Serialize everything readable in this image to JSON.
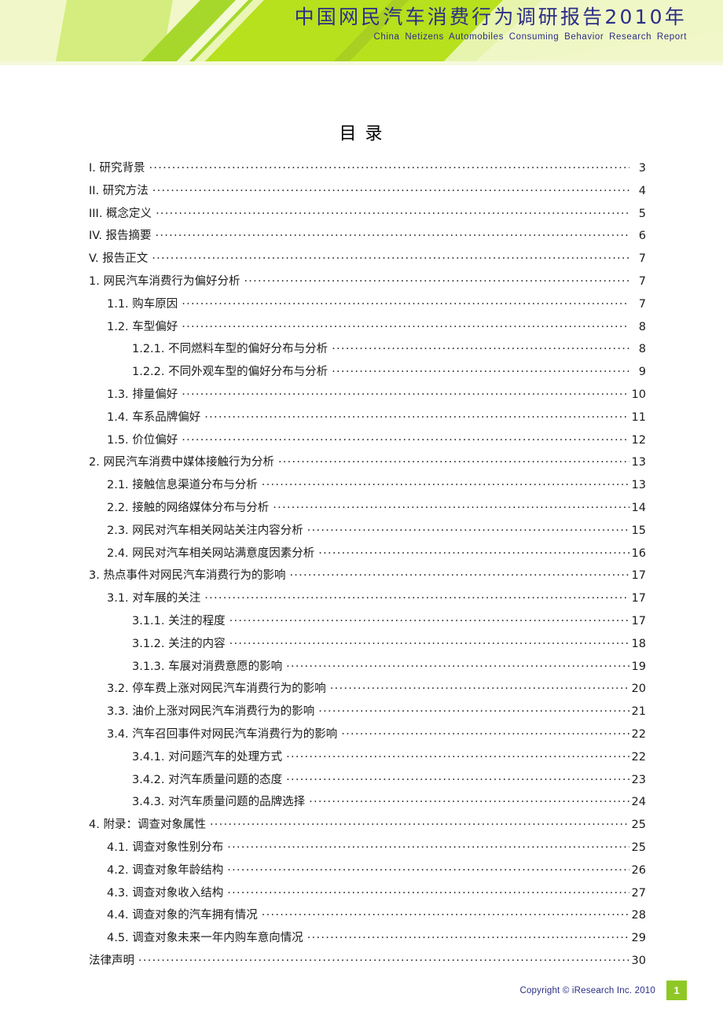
{
  "header": {
    "title_cn": "中国网民汽车消费行为调研报告2010年",
    "title_en": "China  Netizens  Automobiles  Consuming  Behavior  Research  Report",
    "accent_green": "#8fc825",
    "band_pale": "#f2f7c9",
    "band_mid": "#c6e86b",
    "title_color": "#2b2f86"
  },
  "toc": {
    "heading": "目  录",
    "entries": [
      {
        "level": 0,
        "label": "I. 研究背景",
        "page": "3"
      },
      {
        "level": 0,
        "label": "II. 研究方法",
        "page": "4"
      },
      {
        "level": 0,
        "label": "III. 概念定义",
        "page": "5"
      },
      {
        "level": 0,
        "label": "IV. 报告摘要",
        "page": "6"
      },
      {
        "level": 0,
        "label": "V. 报告正文",
        "page": "7"
      },
      {
        "level": 0,
        "label": "1. 网民汽车消费行为偏好分析",
        "page": "7"
      },
      {
        "level": 1,
        "label": "1.1. 购车原因",
        "page": "7"
      },
      {
        "level": 1,
        "label": "1.2. 车型偏好",
        "page": "8"
      },
      {
        "level": 2,
        "label": "1.2.1. 不同燃料车型的偏好分布与分析",
        "page": "8"
      },
      {
        "level": 2,
        "label": "1.2.2. 不同外观车型的偏好分布与分析",
        "page": "9"
      },
      {
        "level": 1,
        "label": "1.3. 排量偏好",
        "page": "10"
      },
      {
        "level": 1,
        "label": "1.4. 车系品牌偏好",
        "page": "11"
      },
      {
        "level": 1,
        "label": "1.5. 价位偏好",
        "page": "12"
      },
      {
        "level": 0,
        "label": "2. 网民汽车消费中媒体接触行为分析",
        "page": "13"
      },
      {
        "level": 1,
        "label": "2.1. 接触信息渠道分布与分析",
        "page": "13"
      },
      {
        "level": 1,
        "label": "2.2. 接触的网络媒体分布与分析",
        "page": "14"
      },
      {
        "level": 1,
        "label": "2.3. 网民对汽车相关网站关注内容分析",
        "page": "15"
      },
      {
        "level": 1,
        "label": "2.4.  网民对汽车相关网站满意度因素分析",
        "page": "16"
      },
      {
        "level": 0,
        "label": "3. 热点事件对网民汽车消费行为的影响",
        "page": "17"
      },
      {
        "level": 1,
        "label": "3.1. 对车展的关注",
        "page": "17"
      },
      {
        "level": 2,
        "label": "3.1.1. 关注的程度",
        "page": "17"
      },
      {
        "level": 2,
        "label": "3.1.2. 关注的内容",
        "page": "18"
      },
      {
        "level": 2,
        "label": "3.1.3. 车展对消费意愿的影响",
        "page": "19"
      },
      {
        "level": 1,
        "label": "3.2. 停车费上涨对网民汽车消费行为的影响",
        "page": "20"
      },
      {
        "level": 1,
        "label": "3.3. 油价上涨对网民汽车消费行为的影响",
        "page": "21"
      },
      {
        "level": 1,
        "label": "3.4. 汽车召回事件对网民汽车消费行为的影响",
        "page": "22"
      },
      {
        "level": 2,
        "label": "3.4.1. 对问题汽车的处理方式",
        "page": "22"
      },
      {
        "level": 2,
        "label": "3.4.2. 对汽车质量问题的态度",
        "page": "23"
      },
      {
        "level": 2,
        "label": "3.4.3. 对汽车质量问题的品牌选择",
        "page": "24"
      },
      {
        "level": 0,
        "label": "4. 附录：调查对象属性",
        "page": "25"
      },
      {
        "level": 1,
        "label": "4.1. 调查对象性别分布",
        "page": "25"
      },
      {
        "level": 1,
        "label": "4.2. 调查对象年龄结构",
        "page": "26"
      },
      {
        "level": 1,
        "label": "4.3. 调查对象收入结构",
        "page": "27"
      },
      {
        "level": 1,
        "label": "4.4. 调查对象的汽车拥有情况",
        "page": "28"
      },
      {
        "level": 1,
        "label": "4.5. 调查对象未来一年内购车意向情况",
        "page": "29"
      },
      {
        "level": 0,
        "label": "法律声明",
        "page": "30"
      }
    ]
  },
  "footer": {
    "copyright": "Copyright © iResearch Inc. 2010",
    "page_number": "1"
  }
}
